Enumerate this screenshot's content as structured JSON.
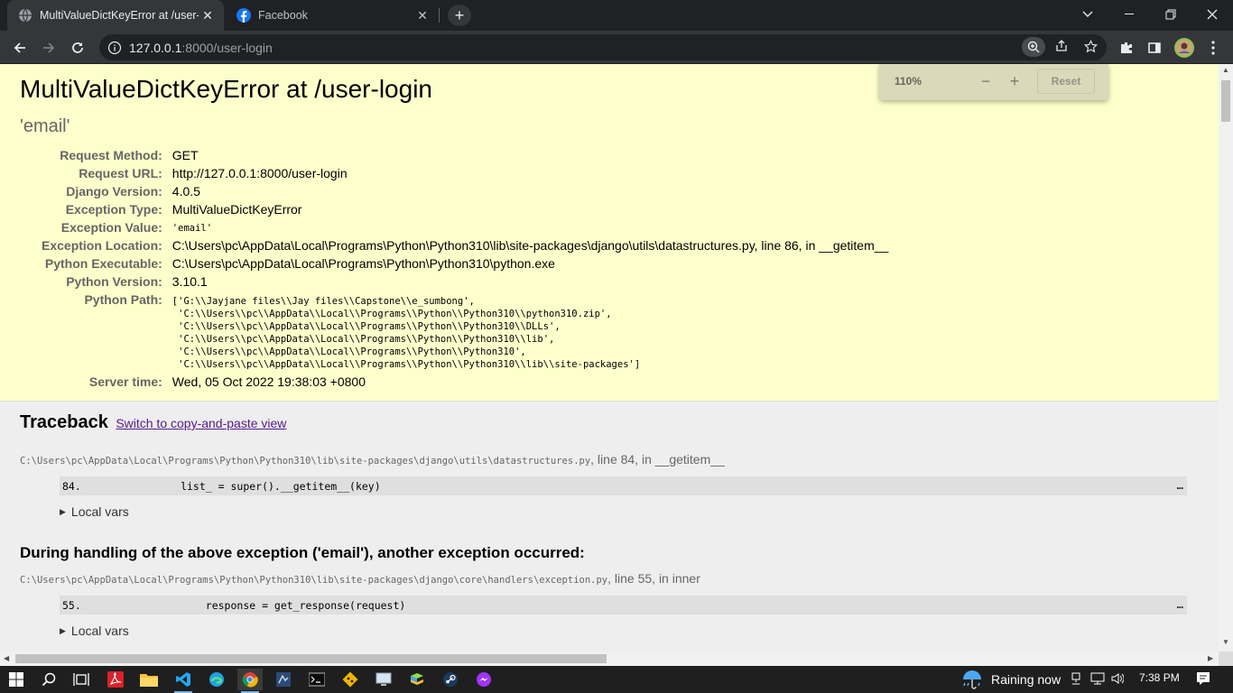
{
  "browser": {
    "tabs": [
      {
        "title": "MultiValueDictKeyError at /user-login",
        "active": true
      },
      {
        "title": "Facebook",
        "active": false
      }
    ],
    "url_host": "127.0.0.1",
    "url_rest": ":8000/user-login",
    "zoom": {
      "level": "110%",
      "minus": "−",
      "plus": "+",
      "reset": "Reset"
    }
  },
  "error": {
    "title": "MultiValueDictKeyError at /user-login",
    "exception_value": "'email'",
    "meta": [
      {
        "label": "Request Method:",
        "value": "GET"
      },
      {
        "label": "Request URL:",
        "value": "http://127.0.0.1:8000/user-login"
      },
      {
        "label": "Django Version:",
        "value": "4.0.5"
      },
      {
        "label": "Exception Type:",
        "value": "MultiValueDictKeyError"
      },
      {
        "label": "Exception Value:",
        "value": "'email'"
      },
      {
        "label": "Exception Location:",
        "value": "C:\\Users\\pc\\AppData\\Local\\Programs\\Python\\Python310\\lib\\site-packages\\django\\utils\\datastructures.py, line 86, in __getitem__"
      },
      {
        "label": "Python Executable:",
        "value": "C:\\Users\\pc\\AppData\\Local\\Programs\\Python\\Python310\\python.exe"
      },
      {
        "label": "Python Version:",
        "value": "3.10.1"
      },
      {
        "label": "Python Path:",
        "lines": [
          "['G:\\\\Jayjane files\\\\Jay files\\\\Capstone\\\\e_sumbong',",
          " 'C:\\\\Users\\\\pc\\\\AppData\\\\Local\\\\Programs\\\\Python\\\\Python310\\\\python310.zip',",
          " 'C:\\\\Users\\\\pc\\\\AppData\\\\Local\\\\Programs\\\\Python\\\\Python310\\\\DLLs',",
          " 'C:\\\\Users\\\\pc\\\\AppData\\\\Local\\\\Programs\\\\Python\\\\Python310\\\\lib',",
          " 'C:\\\\Users\\\\pc\\\\AppData\\\\Local\\\\Programs\\\\Python\\\\Python310',",
          " 'C:\\\\Users\\\\pc\\\\AppData\\\\Local\\\\Programs\\\\Python\\\\Python310\\\\lib\\\\site-packages']"
        ]
      },
      {
        "label": "Server time:",
        "value": "Wed, 05 Oct 2022 19:38:03 +0800"
      }
    ]
  },
  "traceback": {
    "heading": "Traceback",
    "switch_link": "Switch to copy-and-paste view",
    "frames": [
      {
        "path": "C:\\Users\\pc\\AppData\\Local\\Programs\\Python\\Python310\\lib\\site-packages\\django\\utils\\datastructures.py",
        "suffix": ", line 84, in __getitem__",
        "line_no": "84.",
        "code": "            list_ = super().__getitem__(key)",
        "dots": "…",
        "local_vars": "Local vars"
      },
      {
        "path": "C:\\Users\\pc\\AppData\\Local\\Programs\\Python\\Python310\\lib\\site-packages\\django\\core\\handlers\\exception.py",
        "suffix": ", line 55, in inner",
        "line_no": "55.",
        "code": "                response = get_response(request)",
        "dots": "…",
        "local_vars": "Local vars"
      }
    ],
    "during": "During handling of the above exception ('email'), another exception occurred:"
  },
  "taskbar": {
    "weather": "Raining now",
    "time": "7:38 PM"
  },
  "colors": {
    "summary_bg": "#ffffcc",
    "page_bg": "#eeeeee",
    "link": "#551a8b"
  }
}
